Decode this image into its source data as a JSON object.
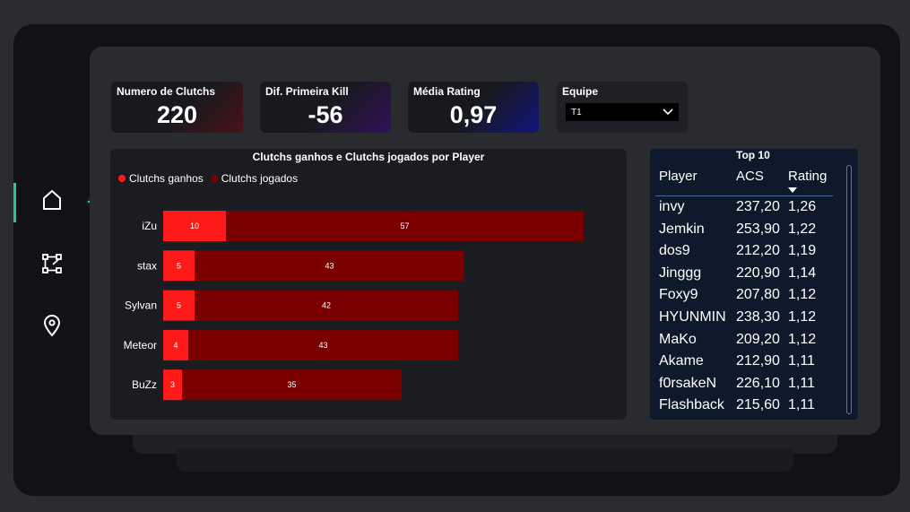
{
  "kpis": {
    "clutchs": {
      "label": "Numero de Clutchs",
      "value": "220"
    },
    "first_kill": {
      "label": "Dif. Primeira Kill",
      "value": "-56"
    },
    "rating": {
      "label": "Média Rating",
      "value": "0,97"
    }
  },
  "filter": {
    "label": "Equipe",
    "selected": "T1"
  },
  "nav": {
    "items": [
      "home-icon",
      "flow-icon",
      "location-icon"
    ],
    "active": "home-icon"
  },
  "colors": {
    "won": "#ff1a1a",
    "played": "#7a0000",
    "accent": "#1fc9a0"
  },
  "chart_data": {
    "type": "bar",
    "orientation": "horizontal",
    "stacked": true,
    "title": "Clutchs ganhos e Clutchs jogados por Player",
    "legend_position": "top-left",
    "categories": [
      "iZu",
      "stax",
      "Sylvan",
      "Meteor",
      "BuZz"
    ],
    "series": [
      {
        "name": "Clutchs ganhos",
        "values": [
          10,
          5,
          5,
          4,
          3
        ]
      },
      {
        "name": "Clutchs jogados",
        "values": [
          57,
          43,
          42,
          43,
          35
        ]
      }
    ]
  },
  "table": {
    "title": "Top 10",
    "headers": [
      "Player",
      "ACS",
      "Rating"
    ],
    "rows": [
      [
        "invy",
        "237,20",
        "1,26"
      ],
      [
        "Jemkin",
        "253,90",
        "1,22"
      ],
      [
        "dos9",
        "212,20",
        "1,19"
      ],
      [
        "Jinggg",
        "220,90",
        "1,14"
      ],
      [
        "Foxy9",
        "207,80",
        "1,12"
      ],
      [
        "HYUNMIN",
        "238,30",
        "1,12"
      ],
      [
        "MaKo",
        "209,20",
        "1,12"
      ],
      [
        "Akame",
        "212,90",
        "1,11"
      ],
      [
        "f0rsakeN",
        "226,10",
        "1,11"
      ],
      [
        "Flashback",
        "215,60",
        "1,11"
      ]
    ]
  }
}
